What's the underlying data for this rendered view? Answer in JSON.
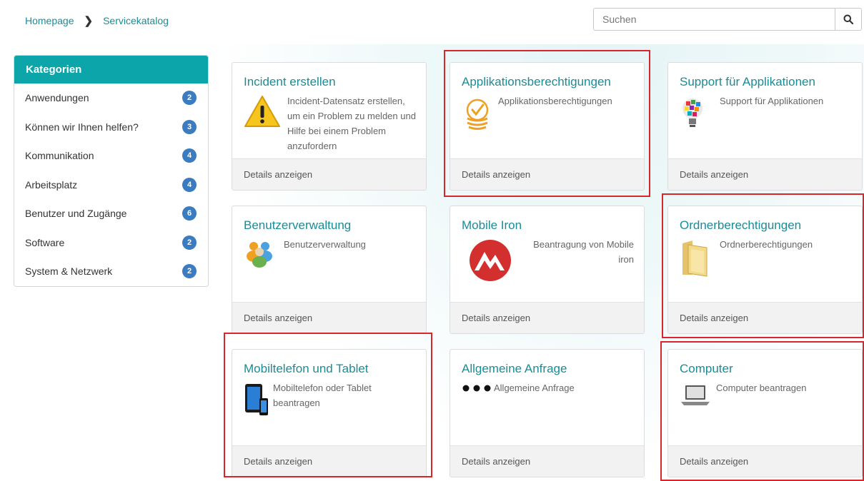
{
  "breadcrumb": {
    "home": "Homepage",
    "current": "Servicekatalog"
  },
  "search": {
    "placeholder": "Suchen",
    "icon": "search-icon"
  },
  "sidebar": {
    "title": "Kategorien",
    "items": [
      {
        "label": "Anwendungen",
        "count": "2"
      },
      {
        "label": "Können wir Ihnen helfen?",
        "count": "3"
      },
      {
        "label": "Kommunikation",
        "count": "4"
      },
      {
        "label": "Arbeitsplatz",
        "count": "4"
      },
      {
        "label": "Benutzer und Zugänge",
        "count": "6"
      },
      {
        "label": "Software",
        "count": "2"
      },
      {
        "label": "System & Netzwerk",
        "count": "2"
      }
    ]
  },
  "colors": {
    "accent": "#0ca5a9",
    "link": "#1a8c96",
    "badge": "#3b7bbf",
    "highlight": "#d9262c"
  },
  "cards": [
    {
      "title": "Incident erstellen",
      "description": "Incident-Datensatz erstellen, um ein Problem zu melden und Hilfe bei einem Problem anzufordern",
      "footer": "Details anzeigen",
      "icon": "warning-icon",
      "highlighted": false
    },
    {
      "title": "Applikationsberechtigungen",
      "description": "Applikationsberechtigungen",
      "footer": "Details anzeigen",
      "icon": "app-permission-icon",
      "highlighted": true
    },
    {
      "title": "Support für Applikationen",
      "description": "Support für Applikationen",
      "footer": "Details anzeigen",
      "icon": "lightbulb-icon",
      "highlighted": false
    },
    {
      "title": "Benutzerverwaltung",
      "description": "Benutzerverwaltung",
      "footer": "Details anzeigen",
      "icon": "users-icon",
      "highlighted": false
    },
    {
      "title": "Mobile Iron",
      "description": "Beantragung von Mobile iron",
      "footer": "Details anzeigen",
      "icon": "mobileiron-logo-icon",
      "highlighted": false
    },
    {
      "title": "Ordnerberechtigungen",
      "description": "Ordnerberechtigungen",
      "footer": "Details anzeigen",
      "icon": "folder-icon",
      "highlighted": true
    },
    {
      "title": "Mobiltelefon und Tablet",
      "description": "Mobiltelefon oder Tablet beantragen",
      "footer": "Details anzeigen",
      "icon": "tablet-phone-icon",
      "highlighted": true
    },
    {
      "title": "Allgemeine Anfrage",
      "description": "Allgemeine Anfrage",
      "footer": "Details anzeigen",
      "icon": "ellipsis-icon",
      "highlighted": false
    },
    {
      "title": "Computer",
      "description": "Computer beantragen",
      "footer": "Details anzeigen",
      "icon": "laptop-icon",
      "highlighted": true
    }
  ]
}
